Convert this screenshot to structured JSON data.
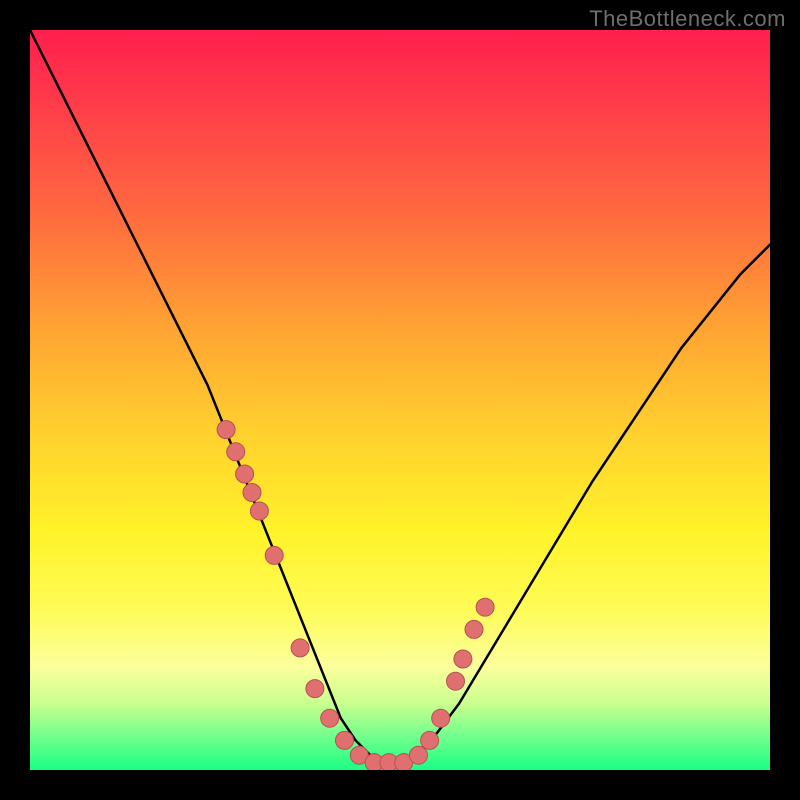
{
  "watermark": "TheBottleneck.com",
  "colors": {
    "frame": "#000000",
    "curve": "#000000",
    "dot_fill": "#e07070",
    "dot_stroke": "#b85050",
    "gradient_top": "#ff1f4d",
    "gradient_bottom": "#1aff85"
  },
  "chart_data": {
    "type": "line",
    "title": "",
    "xlabel": "",
    "ylabel": "",
    "xlim": [
      0,
      100
    ],
    "ylim": [
      0,
      100
    ],
    "curve": {
      "x": [
        0,
        3,
        6,
        9,
        12,
        15,
        18,
        21,
        24,
        26,
        28,
        30,
        32,
        34,
        36,
        38,
        40,
        42,
        44,
        46,
        48,
        50,
        52,
        55,
        58,
        61,
        64,
        67,
        70,
        73,
        76,
        80,
        84,
        88,
        92,
        96,
        100
      ],
      "y": [
        100,
        94,
        88,
        82,
        76,
        70,
        64,
        58,
        52,
        47,
        42,
        37,
        32,
        27,
        22,
        17,
        12,
        7,
        4,
        2,
        1,
        1,
        2,
        5,
        9,
        14,
        19,
        24,
        29,
        34,
        39,
        45,
        51,
        57,
        62,
        67,
        71
      ]
    },
    "dots": {
      "x": [
        26.5,
        27.8,
        29.0,
        30.0,
        31.0,
        33.0,
        36.5,
        38.5,
        40.5,
        42.5,
        44.5,
        46.5,
        48.5,
        50.5,
        52.5,
        54.0,
        55.5,
        57.5,
        58.5,
        60.0,
        61.5
      ],
      "y": [
        46.0,
        43.0,
        40.0,
        37.5,
        35.0,
        29.0,
        16.5,
        11.0,
        7.0,
        4.0,
        2.0,
        1.0,
        1.0,
        1.0,
        2.0,
        4.0,
        7.0,
        12.0,
        15.0,
        19.0,
        22.0
      ]
    }
  }
}
